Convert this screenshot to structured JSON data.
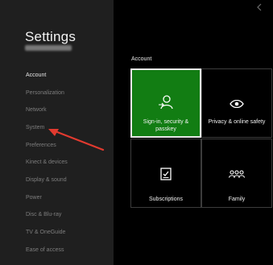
{
  "app": {
    "title": "Settings",
    "gamertag": "CheddarChunky"
  },
  "sidebar": {
    "items": [
      {
        "label": "Account",
        "active": true
      },
      {
        "label": "Personalization"
      },
      {
        "label": "Network"
      },
      {
        "label": "System"
      },
      {
        "label": "Preferences"
      },
      {
        "label": "Kinect & devices"
      },
      {
        "label": "Display & sound"
      },
      {
        "label": "Power"
      },
      {
        "label": "Disc & Blu-ray"
      },
      {
        "label": "TV & OneGuide"
      },
      {
        "label": "Ease of access"
      }
    ]
  },
  "main": {
    "section_title": "Account",
    "tiles": [
      {
        "label": "Sign-in, security & passkey",
        "icon": "person-key-icon",
        "selected": true
      },
      {
        "label": "Privacy & online safety",
        "icon": "eye-icon"
      },
      {
        "label": "Subscriptions",
        "icon": "subscription-card-icon"
      },
      {
        "label": "Family",
        "icon": "family-icon"
      }
    ]
  },
  "annotation": {
    "color": "#e23a2f",
    "points_to": "System"
  },
  "colors": {
    "accent": "#127d13",
    "sidebar_bg": "#1f1f1f",
    "main_bg": "#000000"
  }
}
